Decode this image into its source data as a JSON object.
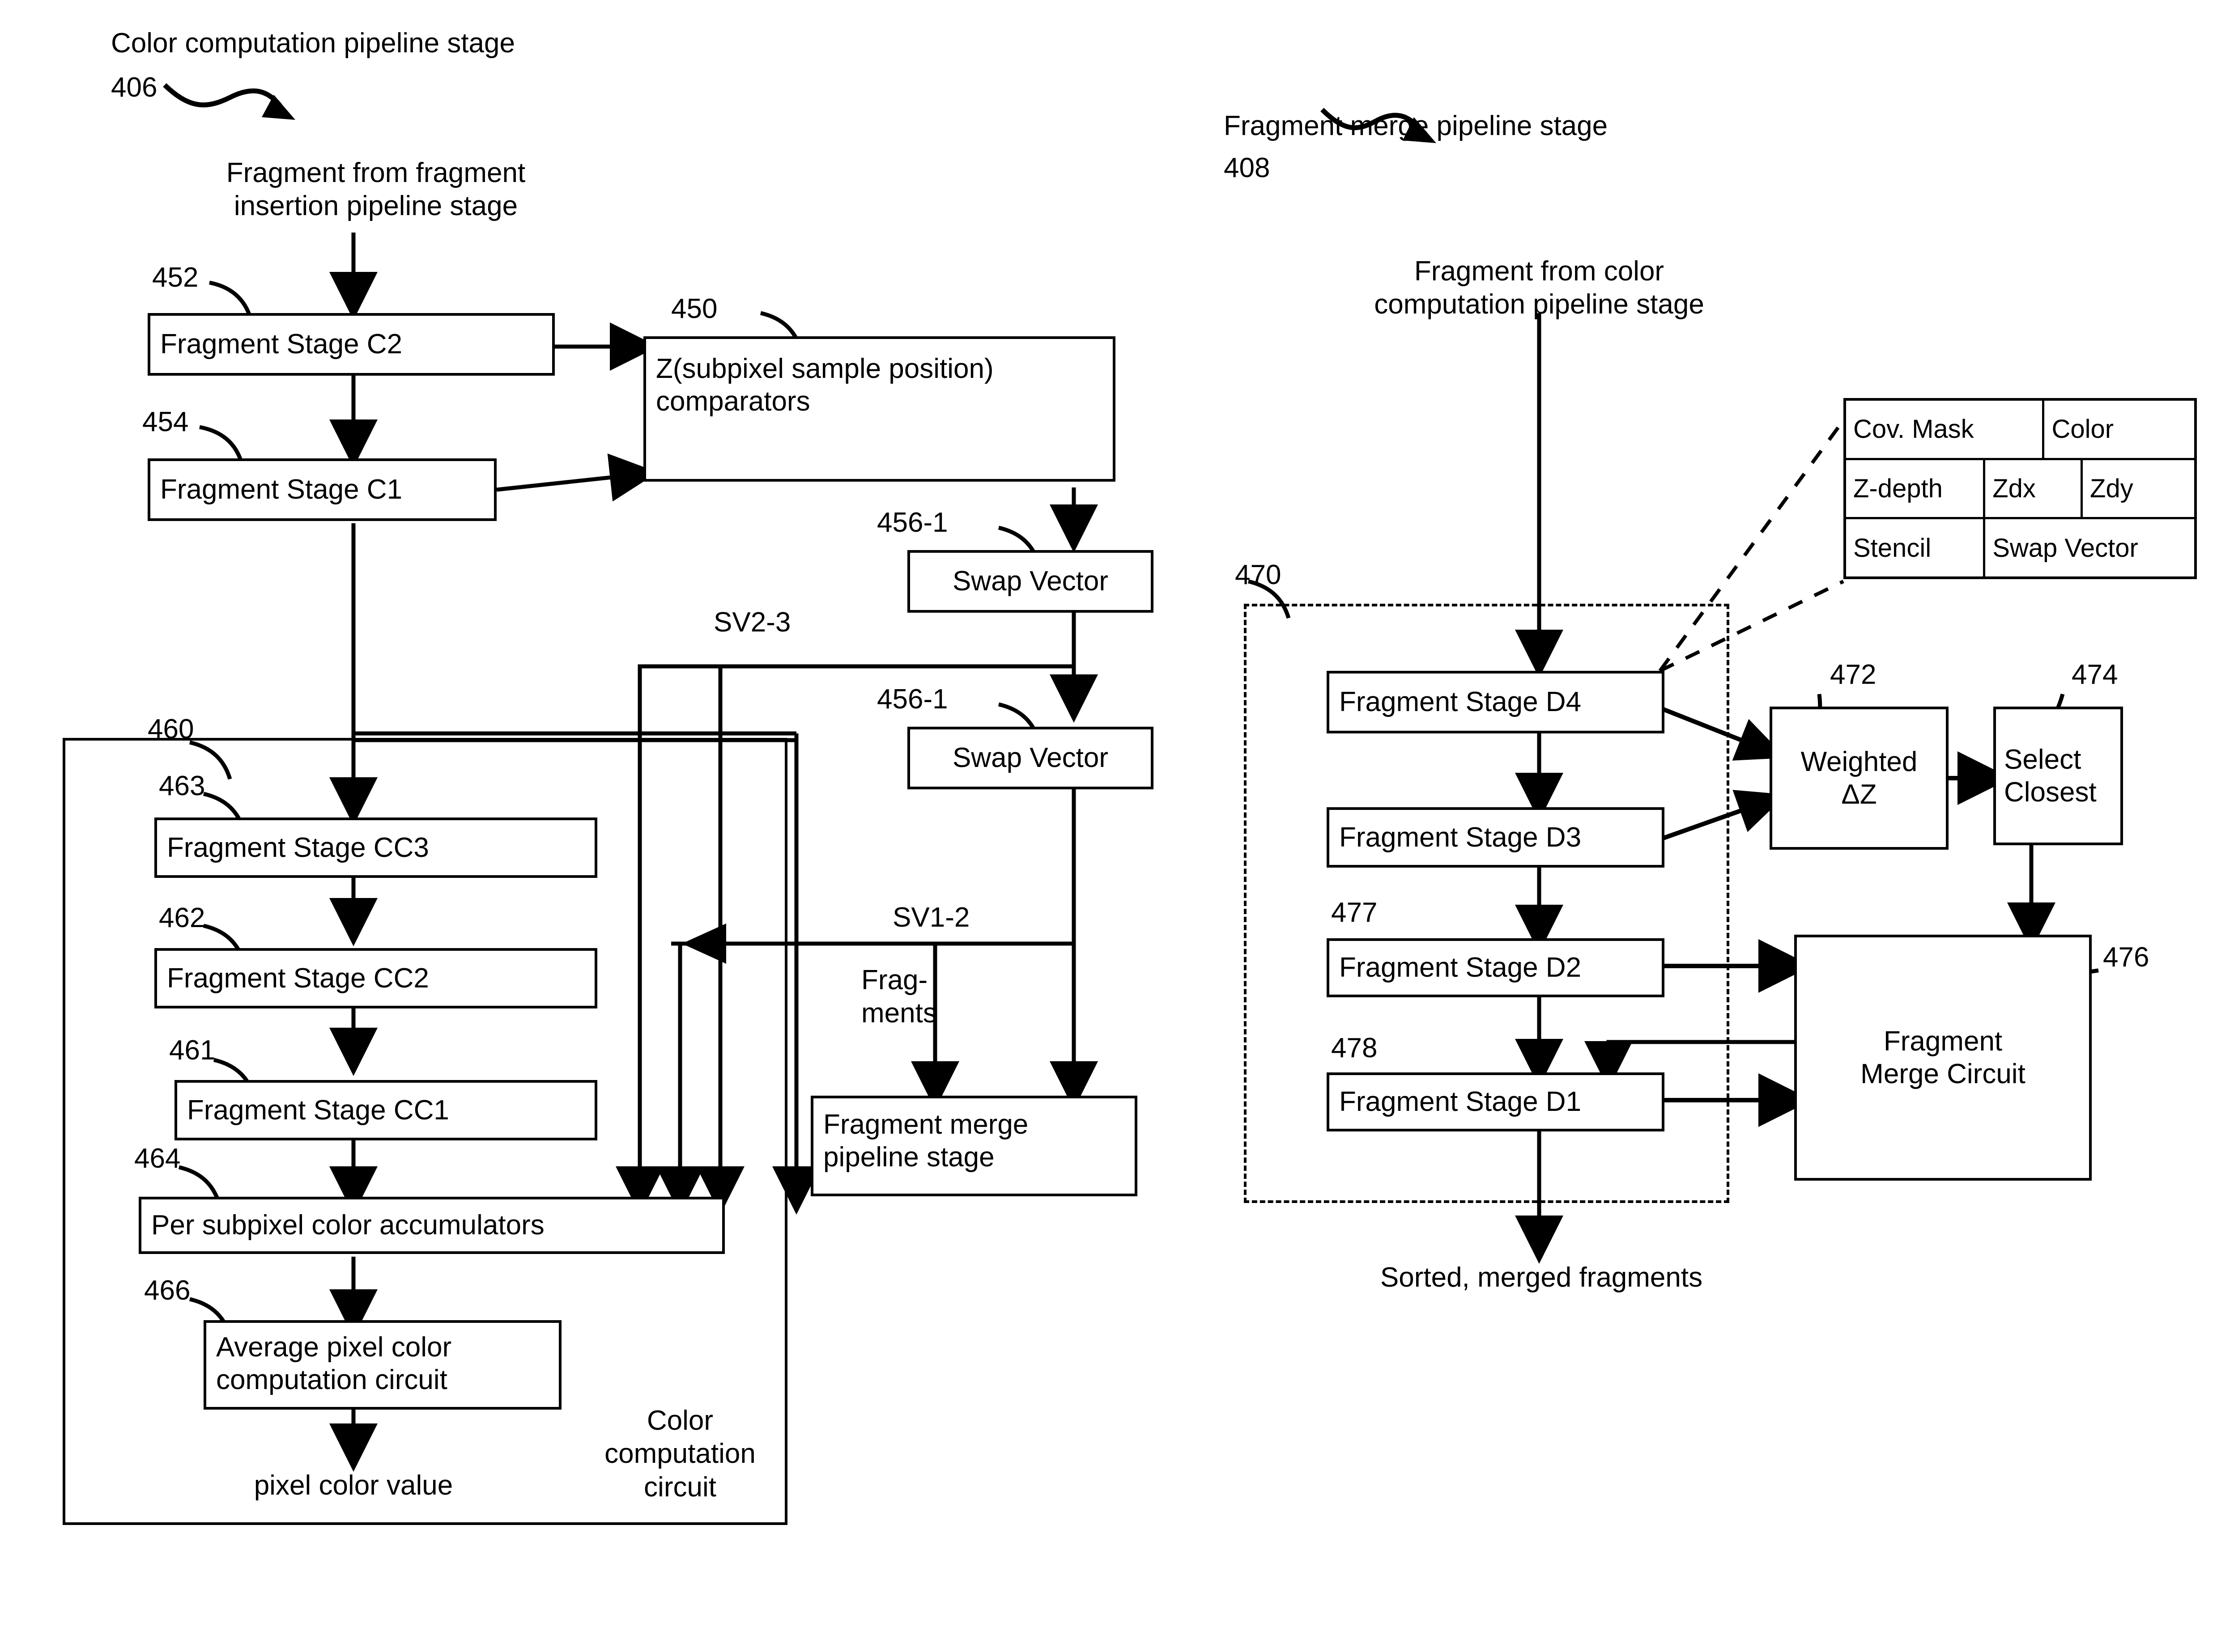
{
  "figure": {
    "left_section": {
      "title": "Color computation pipeline stage",
      "ref": "406",
      "input_label": "Fragment from fragment\ninsertion pipeline stage",
      "output_label": "pixel color value",
      "panel_label": "Color\ncomputation\ncircuit"
    },
    "right_section": {
      "title": "Fragment merge pipeline stage",
      "ref": "408",
      "input_label": "Fragment from color\ncomputation pipeline stage",
      "output_label": "Sorted, merged fragments",
      "group_ref": "470"
    },
    "boxes": {
      "frag_stage_c2": {
        "label": "Fragment Stage C2",
        "ref": "452"
      },
      "frag_stage_c1": {
        "label": "Fragment Stage C1",
        "ref": "454"
      },
      "z_comparators": {
        "label": "Z(subpixel sample position)\ncomparators",
        "ref": "450"
      },
      "swap_vector_top": {
        "label": "Swap Vector",
        "ref": "456-1"
      },
      "swap_vector_bottom": {
        "label": "Swap Vector",
        "ref": "456-1"
      },
      "frag_stage_cc3": {
        "label": "Fragment Stage CC3",
        "ref": "463"
      },
      "frag_stage_cc2": {
        "label": "Fragment Stage CC2",
        "ref": "462"
      },
      "frag_stage_cc1": {
        "label": "Fragment Stage CC1",
        "ref": "461"
      },
      "accumulators": {
        "label": "Per subpixel color accumulators",
        "ref": "464"
      },
      "avg_pixel_color": {
        "label": "Average pixel color\ncomputation circuit",
        "ref": "466"
      },
      "frag_merge_stage": {
        "label": "Fragment merge\npipeline stage",
        "ref": ""
      },
      "frag_stage_d4": {
        "label": "Fragment Stage D4",
        "ref": ""
      },
      "frag_stage_d3": {
        "label": "Fragment Stage D3",
        "ref": ""
      },
      "frag_stage_d2": {
        "label": "Fragment Stage D2",
        "ref": "477"
      },
      "frag_stage_d1": {
        "label": "Fragment Stage D1",
        "ref": "478"
      },
      "weighted_dz": {
        "label": "Weighted\nΔZ",
        "ref": "472"
      },
      "select_closest": {
        "label": "Select\nClosest",
        "ref": "474"
      },
      "frag_merge_circuit": {
        "label": "Fragment\nMerge Circuit",
        "ref": "476"
      },
      "color_computation_panel": {
        "ref": "460"
      }
    },
    "signals": {
      "sv2_3": "SV2-3",
      "sv1_2": "SV1-2",
      "fragments": "Frag-\nments"
    },
    "fragment_struct": {
      "rows": [
        [
          "Cov. Mask",
          "Color"
        ],
        [
          "Z-depth",
          "Zdx",
          "Zdy"
        ],
        [
          "Stencil",
          "Swap Vector"
        ]
      ]
    }
  }
}
